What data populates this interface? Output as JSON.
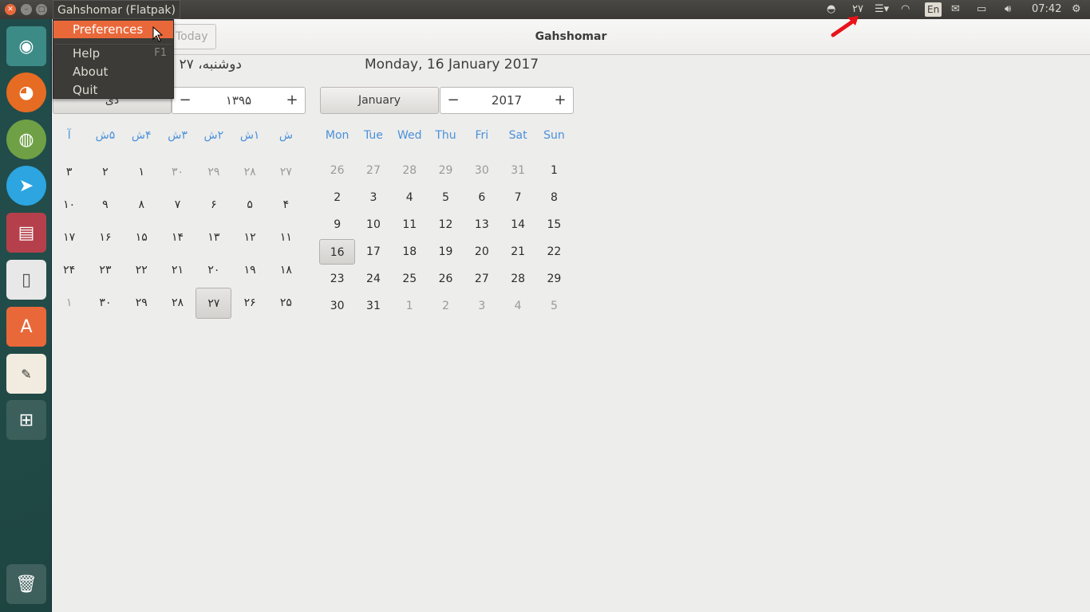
{
  "topbar": {
    "app_title": "Gahshomar (Flatpak)",
    "indicator_date": "۲۷",
    "keyboard": "En",
    "clock": "07:42"
  },
  "menu": {
    "items": [
      {
        "label": "Preferences",
        "accel": ""
      },
      {
        "label": "Help",
        "accel": "F1"
      },
      {
        "label": "About",
        "accel": ""
      },
      {
        "label": "Quit",
        "accel": ""
      }
    ]
  },
  "header": {
    "today_label": "Today",
    "title": "Gahshomar"
  },
  "persian": {
    "date_header": "دوشنبه، ۲۷",
    "month": "دی",
    "year": "۱۳۹۵",
    "weekdays": [
      "ش",
      "۱ش",
      "۲ش",
      "۳ش",
      "۴ش",
      "۵ش",
      "آ"
    ],
    "days": [
      [
        "۲۷",
        "۲۸",
        "۲۹",
        "۳۰",
        "۱",
        "۲",
        "۳"
      ],
      [
        "۴",
        "۵",
        "۶",
        "۷",
        "۸",
        "۹",
        "۱۰"
      ],
      [
        "۱۱",
        "۱۲",
        "۱۳",
        "۱۴",
        "۱۵",
        "۱۶",
        "۱۷"
      ],
      [
        "۱۸",
        "۱۹",
        "۲۰",
        "۲۱",
        "۲۲",
        "۲۳",
        "۲۴"
      ],
      [
        "۲۵",
        "۲۶",
        "۲۷",
        "۲۸",
        "۲۹",
        "۳۰",
        "۱"
      ]
    ],
    "dim": [
      [
        0,
        0
      ],
      [
        0,
        1
      ],
      [
        0,
        2
      ],
      [
        0,
        3
      ],
      [
        4,
        6
      ]
    ],
    "selected": [
      4,
      2
    ]
  },
  "gregorian": {
    "date_header": "Monday, 16 January 2017",
    "month": "January",
    "year": "2017",
    "weekdays": [
      "Mon",
      "Tue",
      "Wed",
      "Thu",
      "Fri",
      "Sat",
      "Sun"
    ],
    "days": [
      [
        "26",
        "27",
        "28",
        "29",
        "30",
        "31",
        "1"
      ],
      [
        "2",
        "3",
        "4",
        "5",
        "6",
        "7",
        "8"
      ],
      [
        "9",
        "10",
        "11",
        "12",
        "13",
        "14",
        "15"
      ],
      [
        "16",
        "17",
        "18",
        "19",
        "20",
        "21",
        "22"
      ],
      [
        "23",
        "24",
        "25",
        "26",
        "27",
        "28",
        "29"
      ],
      [
        "30",
        "31",
        "1",
        "2",
        "3",
        "4",
        "5"
      ]
    ],
    "dim": [
      [
        0,
        0
      ],
      [
        0,
        1
      ],
      [
        0,
        2
      ],
      [
        0,
        3
      ],
      [
        0,
        4
      ],
      [
        0,
        5
      ],
      [
        5,
        2
      ],
      [
        5,
        3
      ],
      [
        5,
        4
      ],
      [
        5,
        5
      ],
      [
        5,
        6
      ]
    ],
    "selected": [
      3,
      0
    ]
  },
  "colors": {
    "accent": "#e9683a",
    "weekday": "#4a90d9",
    "panel": "#3c3b37"
  }
}
